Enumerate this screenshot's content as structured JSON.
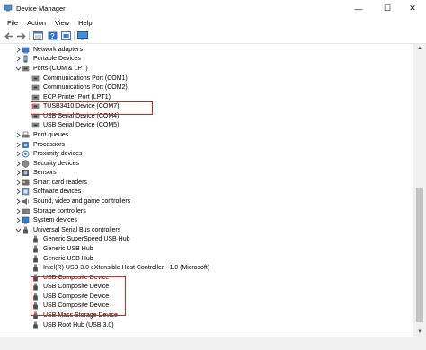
{
  "window": {
    "title": "Device Manager",
    "controls": {
      "minimize": "—",
      "maximize": "☐",
      "close": "✕"
    }
  },
  "menu": [
    "File",
    "Action",
    "View",
    "Help"
  ],
  "toolbar_icons": [
    "back-arrow-icon",
    "forward-arrow-icon",
    "properties-icon",
    "help-icon",
    "scan-hardware-icon",
    "monitor-icon"
  ],
  "tree": [
    {
      "label": "Network adapters",
      "icon": "network-adapter-icon",
      "level": 1,
      "expander": "collapsed"
    },
    {
      "label": "Portable Devices",
      "icon": "portable-device-icon",
      "level": 1,
      "expander": "collapsed"
    },
    {
      "label": "Ports (COM & LPT)",
      "icon": "port-icon",
      "level": 1,
      "expander": "expanded"
    },
    {
      "label": "Communications Port (COM1)",
      "icon": "port-icon",
      "level": 2
    },
    {
      "label": "Communications Port (COM2)",
      "icon": "port-icon",
      "level": 2
    },
    {
      "label": "ECP Printer Port (LPT1)",
      "icon": "port-icon",
      "level": 2
    },
    {
      "label": "TUSB3410 Device (COM7)",
      "icon": "port-icon",
      "level": 2
    },
    {
      "label": "USB Serial Device (COM4)",
      "icon": "port-icon",
      "level": 2
    },
    {
      "label": "USB Serial Device (COM5)",
      "icon": "port-icon",
      "level": 2
    },
    {
      "label": "Print queues",
      "icon": "printer-icon",
      "level": 1,
      "expander": "collapsed"
    },
    {
      "label": "Processors",
      "icon": "processor-icon",
      "level": 1,
      "expander": "collapsed"
    },
    {
      "label": "Proximity devices",
      "icon": "proximity-icon",
      "level": 1,
      "expander": "collapsed"
    },
    {
      "label": "Security devices",
      "icon": "security-icon",
      "level": 1,
      "expander": "collapsed"
    },
    {
      "label": "Sensors",
      "icon": "sensor-icon",
      "level": 1,
      "expander": "collapsed"
    },
    {
      "label": "Smart card readers",
      "icon": "smart-card-icon",
      "level": 1,
      "expander": "collapsed"
    },
    {
      "label": "Software devices",
      "icon": "software-device-icon",
      "level": 1,
      "expander": "collapsed"
    },
    {
      "label": "Sound, video and game controllers",
      "icon": "sound-icon",
      "level": 1,
      "expander": "collapsed"
    },
    {
      "label": "Storage controllers",
      "icon": "storage-icon",
      "level": 1,
      "expander": "collapsed"
    },
    {
      "label": "System devices",
      "icon": "system-device-icon",
      "level": 1,
      "expander": "collapsed"
    },
    {
      "label": "Universal Serial Bus controllers",
      "icon": "usb-controller-icon",
      "level": 1,
      "expander": "expanded"
    },
    {
      "label": "Generic SuperSpeed USB Hub",
      "icon": "usb-plug-icon",
      "level": 2
    },
    {
      "label": "Generic USB Hub",
      "icon": "usb-plug-icon",
      "level": 2
    },
    {
      "label": "Generic USB Hub",
      "icon": "usb-plug-icon",
      "level": 2
    },
    {
      "label": "Intel(R) USB 3.0 eXtensible Host Controller - 1.0 (Microsoft)",
      "icon": "usb-plug-icon",
      "level": 2
    },
    {
      "label": "USB Composite Device",
      "icon": "usb-plug-icon",
      "level": 2
    },
    {
      "label": "USB Composite Device",
      "icon": "usb-plug-icon",
      "level": 2
    },
    {
      "label": "USB Composite Device",
      "icon": "usb-plug-icon",
      "level": 2
    },
    {
      "label": "USB Composite Device",
      "icon": "usb-plug-icon",
      "level": 2
    },
    {
      "label": "USB Mass Storage Device",
      "icon": "usb-plug-icon",
      "level": 2
    },
    {
      "label": "USB Root Hub (USB 3.0)",
      "icon": "usb-plug-icon",
      "level": 2
    }
  ],
  "colors": {
    "highlight": "#e02020",
    "accent": "#1e6fd0"
  }
}
